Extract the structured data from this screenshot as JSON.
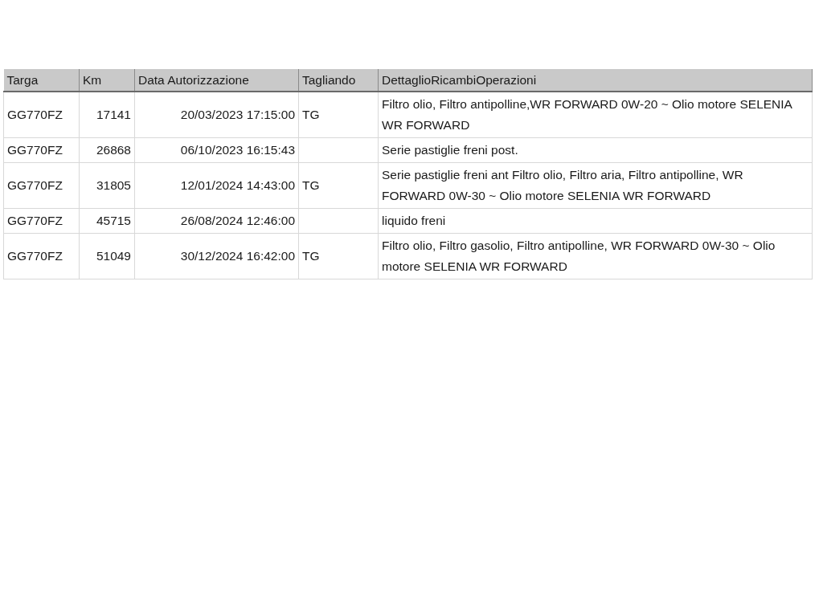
{
  "table": {
    "columns": [
      "Targa",
      "Km",
      "Data Autorizzazione",
      "Tagliando",
      "DettaglioRicambiOperazioni"
    ],
    "rows": [
      {
        "targa": "GG770FZ",
        "km": "17141",
        "data": "20/03/2023 17:15:00",
        "tagliando": "TG",
        "dettaglio": "Filtro olio, Filtro antipolline,WR FORWARD 0W-20 ~ Olio motore SELENIA WR FORWARD"
      },
      {
        "targa": "GG770FZ",
        "km": "26868",
        "data": "06/10/2023 16:15:43",
        "dettaglio": "Serie pastiglie freni post."
      },
      {
        "targa": "GG770FZ",
        "km": "31805",
        "data": "12/01/2024 14:43:00",
        "tagliando": "TG",
        "dettaglio": "Serie pastiglie freni ant Filtro olio, Filtro aria, Filtro antipolline, WR FORWARD 0W-30 ~ Olio motore SELENIA WR FORWARD"
      },
      {
        "targa": "GG770FZ",
        "km": "45715",
        "data": "26/08/2024 12:46:00",
        "dettaglio": "liquido freni"
      },
      {
        "targa": "GG770FZ",
        "km": "51049",
        "data": "30/12/2024 16:42:00",
        "tagliando": "TG",
        "dettaglio": "Filtro olio, Filtro gasolio, Filtro antipolline, WR FORWARD 0W-30 ~ Olio motore SELENIA WR FORWARD"
      }
    ]
  }
}
